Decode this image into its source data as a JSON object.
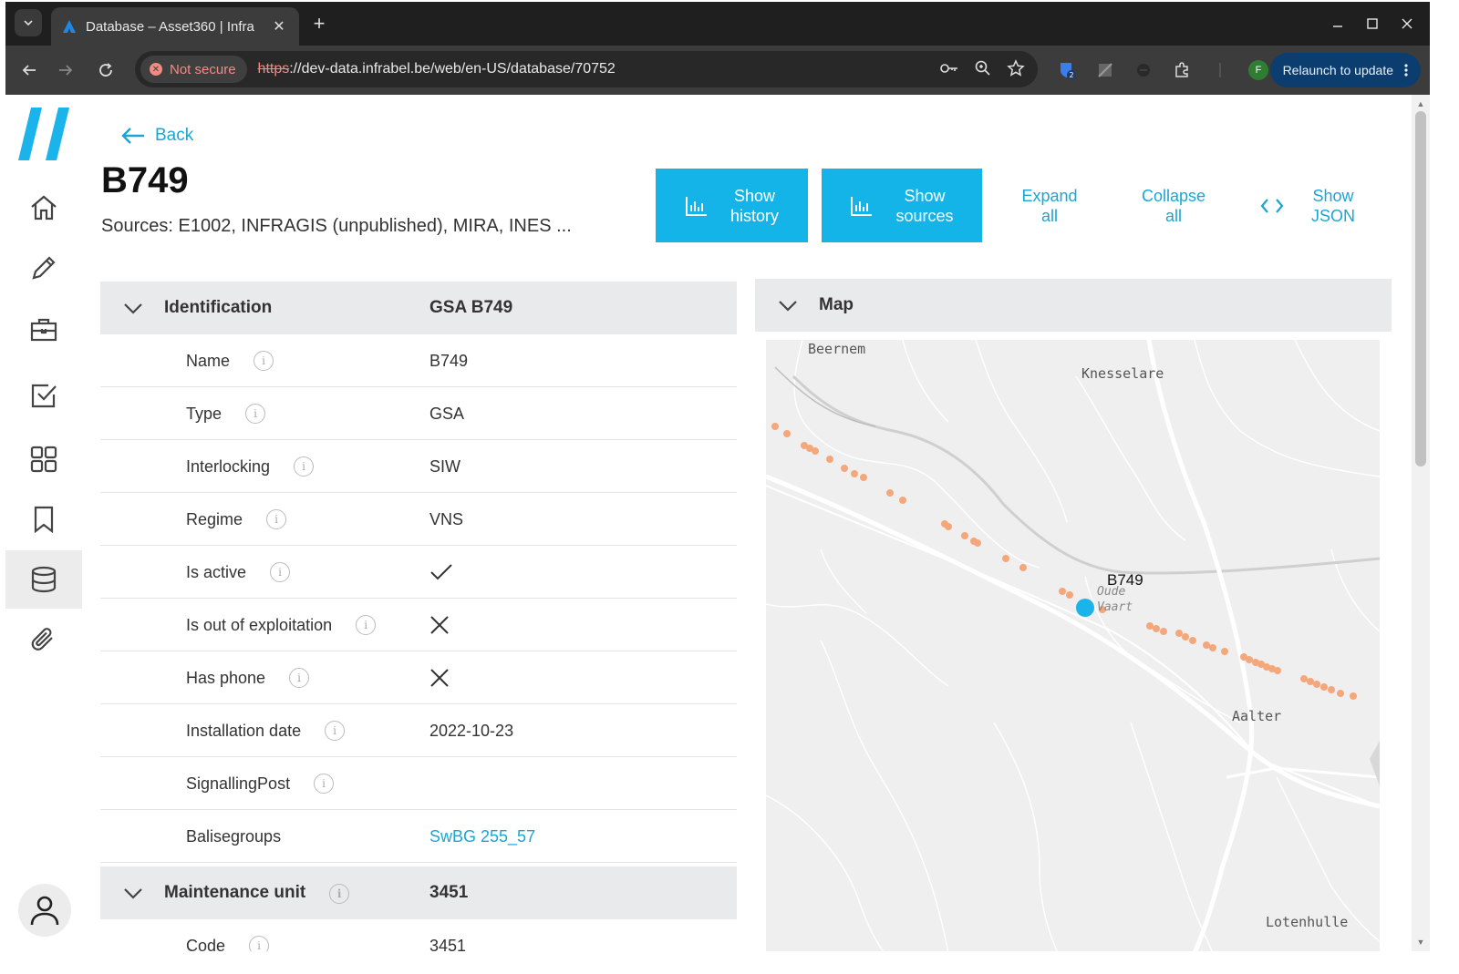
{
  "browser": {
    "tab_title": "Database – Asset360 | Infra",
    "tab_close": "✕",
    "new_tab": "+",
    "not_secure": "Not secure",
    "url_scheme": "https",
    "url_rest": "://dev-data.infrabel.be/web/en-US/database/70752",
    "relaunch": "Relaunch to update",
    "profile_initial": "F",
    "ext_badge": "2"
  },
  "page": {
    "back_label": "Back",
    "title": "B749",
    "sources": "Sources: E1002, INFRAGIS (unpublished), MIRA, INES ..."
  },
  "actions": {
    "show_history_1": "Show",
    "show_history_2": "history",
    "show_sources_1": "Show",
    "show_sources_2": "sources",
    "expand_1": "Expand",
    "expand_2": "all",
    "collapse_1": "Collapse",
    "collapse_2": "all",
    "json_1": "Show",
    "json_2": "JSON"
  },
  "identification": {
    "label": "Identification",
    "value": "GSA B749",
    "rows": [
      {
        "label": "Name",
        "value": "B749"
      },
      {
        "label": "Type",
        "value": "GSA"
      },
      {
        "label": "Interlocking",
        "value": "SIW"
      },
      {
        "label": "Regime",
        "value": "VNS"
      },
      {
        "label": "Is active",
        "value": ""
      },
      {
        "label": "Is out of exploitation",
        "value": ""
      },
      {
        "label": "Has phone",
        "value": ""
      },
      {
        "label": "Installation date",
        "value": "2022-10-23"
      },
      {
        "label": "SignallingPost",
        "value": ""
      },
      {
        "label": "Balisegroups",
        "value": "SwBG 255_57"
      }
    ],
    "boolean_icons": {
      "is_active": "check-icon",
      "is_out_of_exploitation": "cross-icon",
      "has_phone": "cross-icon"
    }
  },
  "maintenance": {
    "label": "Maintenance unit",
    "value": "3451",
    "rows": [
      {
        "label": "Code",
        "value": "3451"
      }
    ]
  },
  "map": {
    "label": "Map",
    "places": [
      "Beernem",
      "Knesselare",
      "Aalter",
      "Lotenhulle"
    ],
    "marker_label": "B749",
    "waterway_1": "Oude",
    "waterway_2": "Vaart"
  },
  "colors": {
    "accent": "#14b4e8",
    "link": "#1aa6d4",
    "marker_blue": "#1ab3ea",
    "dot_orange": "#f5a77c"
  }
}
